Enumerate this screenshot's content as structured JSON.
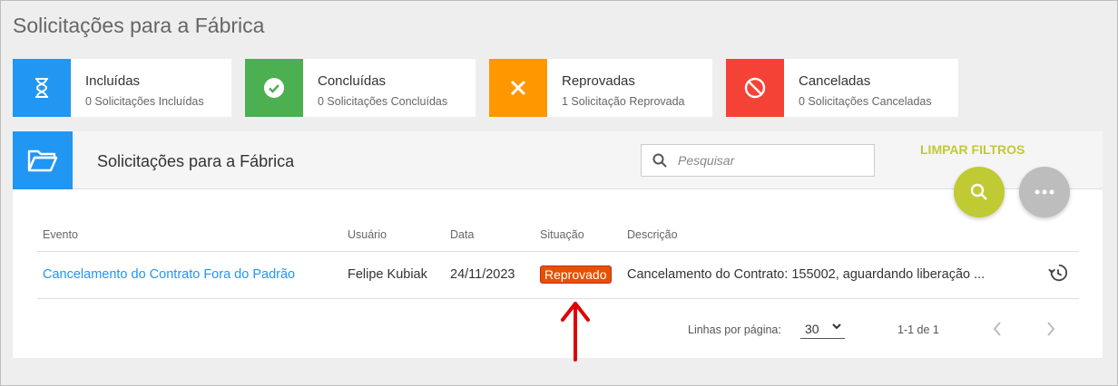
{
  "page": {
    "title": "Solicitações para a Fábrica"
  },
  "cards": [
    {
      "title": "Incluídas",
      "subtitle": "0 Solicitações Incluídas",
      "color": "#2196f3",
      "icon": "hourglass-icon"
    },
    {
      "title": "Concluídas",
      "subtitle": "0 Solicitações Concluídas",
      "color": "#4caf50",
      "icon": "check-circle-icon"
    },
    {
      "title": "Reprovadas",
      "subtitle": "1 Solicitação Reprovada",
      "color": "#ff9800",
      "icon": "close-icon"
    },
    {
      "title": "Canceladas",
      "subtitle": "0 Solicitações Canceladas",
      "color": "#f44336",
      "icon": "block-icon"
    }
  ],
  "panel": {
    "title": "Solicitações para a Fábrica",
    "search_placeholder": "Pesquisar",
    "clear_filters": "LIMPAR FILTROS"
  },
  "table": {
    "headers": [
      "Evento",
      "Usuário",
      "Data",
      "Situação",
      "Descrição"
    ],
    "rows": [
      {
        "evento": "Cancelamento do Contrato Fora do Padrão",
        "usuario": "Felipe Kubiak",
        "data": "24/11/2023",
        "situacao": "Reprovado",
        "descricao": "Cancelamento do Contrato: 155002, aguardando liberação ..."
      }
    ]
  },
  "pagination": {
    "rows_per_page_label": "Linhas por página:",
    "rows_per_page": "30",
    "range": "1-1 de 1"
  },
  "colors": {
    "accent": "#2196f3",
    "lime": "#c0ca33",
    "status_reprovado": "#e65100",
    "annotation_arrow": "#e00000"
  }
}
